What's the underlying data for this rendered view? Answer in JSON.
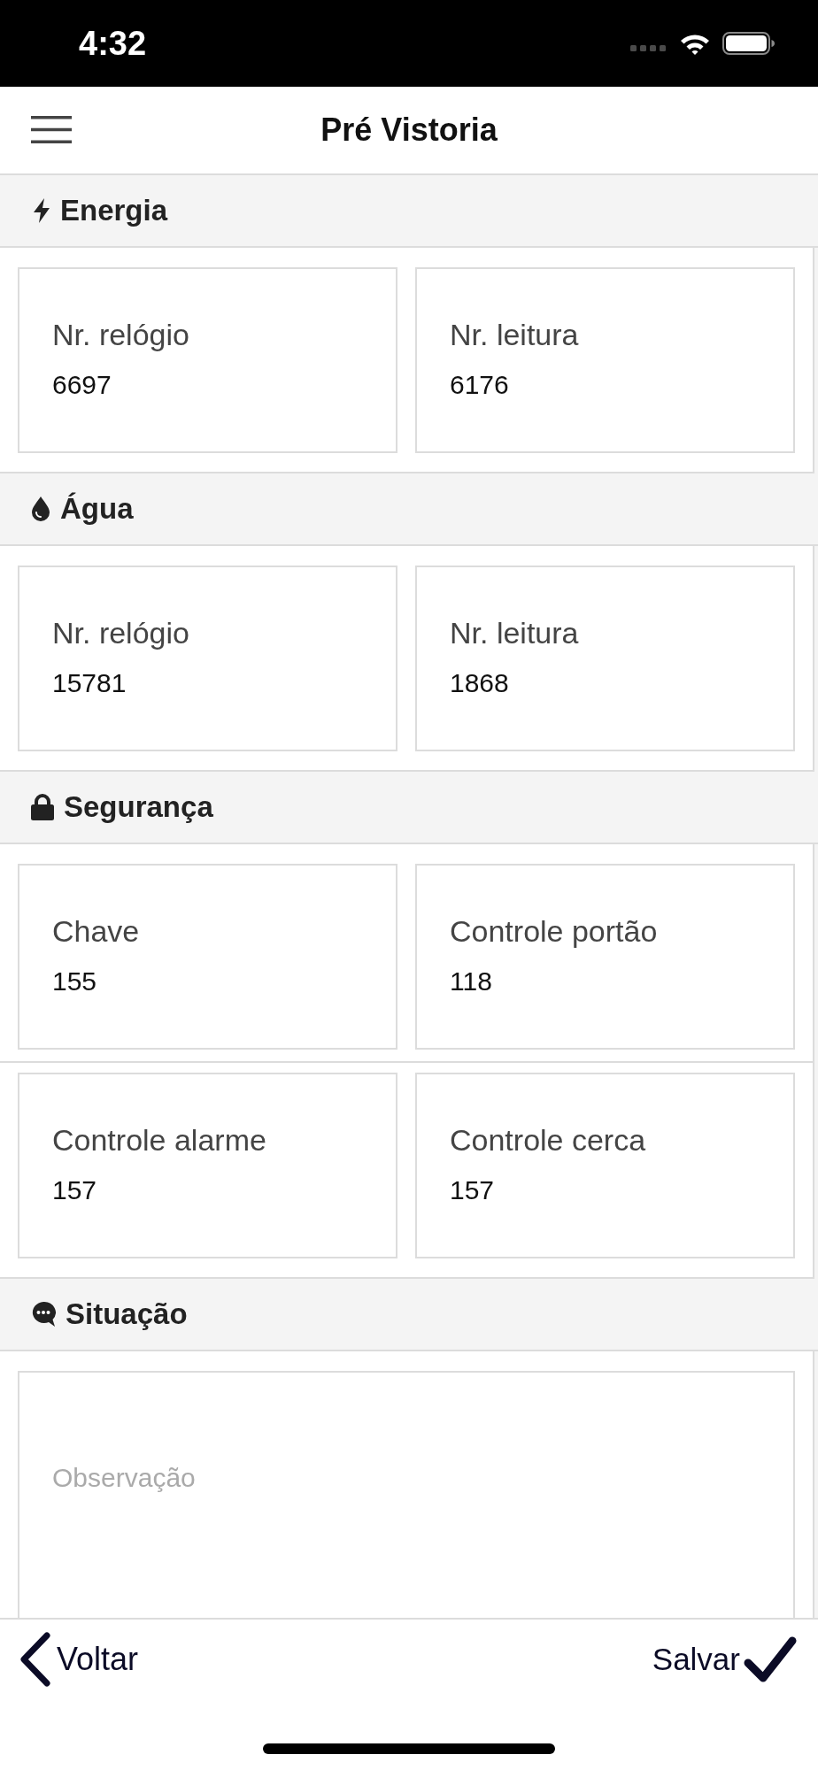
{
  "status_bar": {
    "time": "4:32"
  },
  "nav_bar": {
    "title": "Pré Vistoria"
  },
  "sections": [
    {
      "title": "Energia",
      "kind": "fields",
      "rows": [
        {
          "fields": [
            {
              "label": "Nr. relógio",
              "value": "6697"
            },
            {
              "label": "Nr. leitura",
              "value": "6176"
            }
          ]
        }
      ]
    },
    {
      "title": "Água",
      "kind": "fields",
      "rows": [
        {
          "fields": [
            {
              "label": "Nr. relógio",
              "value": "15781"
            },
            {
              "label": "Nr. leitura",
              "value": "1868"
            }
          ]
        }
      ]
    },
    {
      "title": "Segurança",
      "kind": "fields",
      "rows": [
        {
          "fields": [
            {
              "label": "Chave",
              "value": "155"
            },
            {
              "label": "Controle portão",
              "value": "118"
            }
          ]
        },
        {
          "fields": [
            {
              "label": "Controle alarme",
              "value": "157"
            },
            {
              "label": "Controle cerca",
              "value": "157"
            }
          ]
        }
      ]
    },
    {
      "title": "Situação",
      "kind": "notes",
      "placeholder": "Observação"
    }
  ],
  "footer": {
    "back": "Voltar",
    "save": "Salvar"
  }
}
